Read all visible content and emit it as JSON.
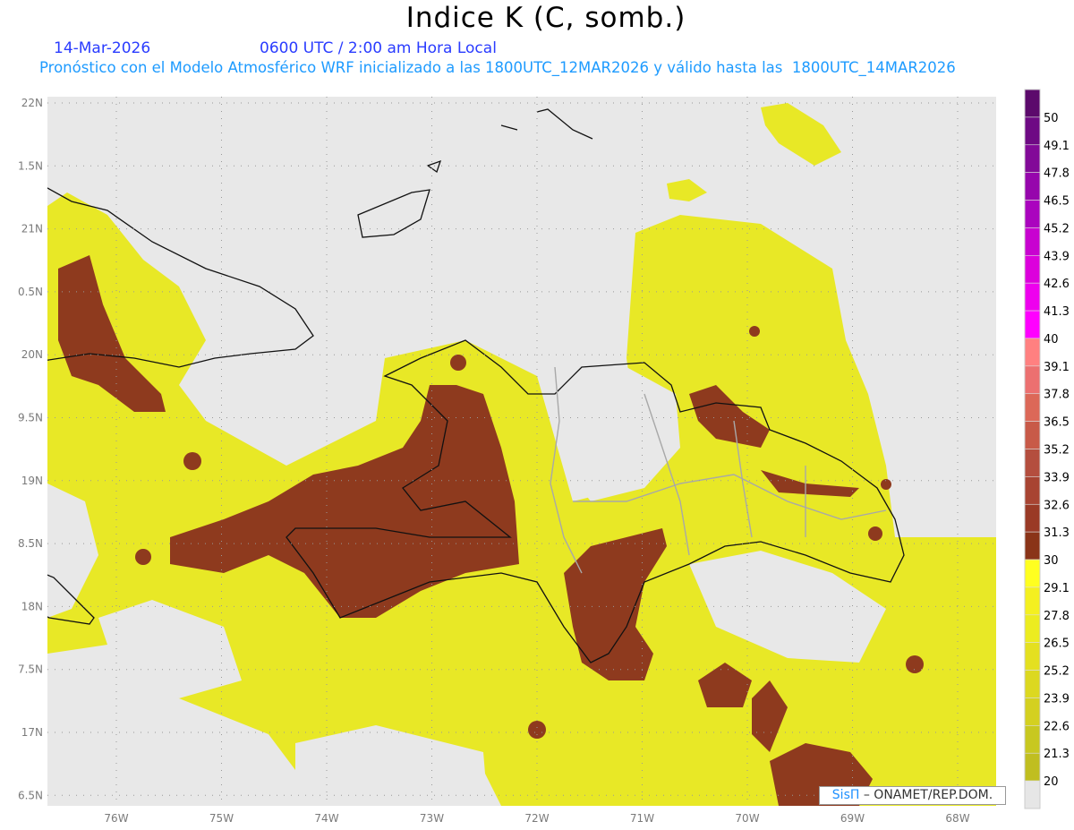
{
  "title": "Indice K (C, somb.)",
  "date": "14-Mar-2026",
  "time": "0600 UTC / 2:00 am Hora Local",
  "model_line": "Pronóstico con el Modelo Atmosférico WRF inicializado a las 1800UTC_12MAR2026 y válido hasta las  1800UTC_14MAR2026",
  "lat_labels": [
    "22N",
    "1.5N",
    "21N",
    "0.5N",
    "20N",
    "9.5N",
    "19N",
    "8.5N",
    "18N",
    "7.5N",
    "17N",
    "6.5N"
  ],
  "lon_labels": [
    "76W",
    "75W",
    "74W",
    "73W",
    "72W",
    "71W",
    "70W",
    "69W",
    "68W"
  ],
  "colorbar": {
    "labels": [
      "50",
      "49.1",
      "47.8",
      "46.5",
      "45.2",
      "43.9",
      "42.6",
      "41.3",
      "40",
      "39.1",
      "37.8",
      "36.5",
      "35.2",
      "33.9",
      "32.6",
      "31.3",
      "30",
      "29.1",
      "27.8",
      "26.5",
      "25.2",
      "23.9",
      "22.6",
      "21.3",
      "20"
    ],
    "colors": [
      "#5c0a6c",
      "#6e0a84",
      "#820a98",
      "#9606ac",
      "#aa04be",
      "#c802d0",
      "#dc00dc",
      "#ee00ee",
      "#ff00ff",
      "#ff8080",
      "#ec7070",
      "#dc6858",
      "#c85a48",
      "#b44e3e",
      "#a84432",
      "#9a3a26",
      "#8a3418",
      "#ffff20",
      "#f4f020",
      "#ecec20",
      "#e4e020",
      "#dcd820",
      "#d4d020",
      "#c8c820",
      "#c0be20",
      "#e6e6e6"
    ]
  },
  "credit": {
    "brand": "SisΠ",
    "text": " –  ONAMET/REP.DOM."
  },
  "colors": {
    "nodata": "#e8e8e8",
    "yellow": "#e8e826",
    "brown": "#8e3a1e",
    "coast": "#111111",
    "border": "#a8a8a8"
  }
}
